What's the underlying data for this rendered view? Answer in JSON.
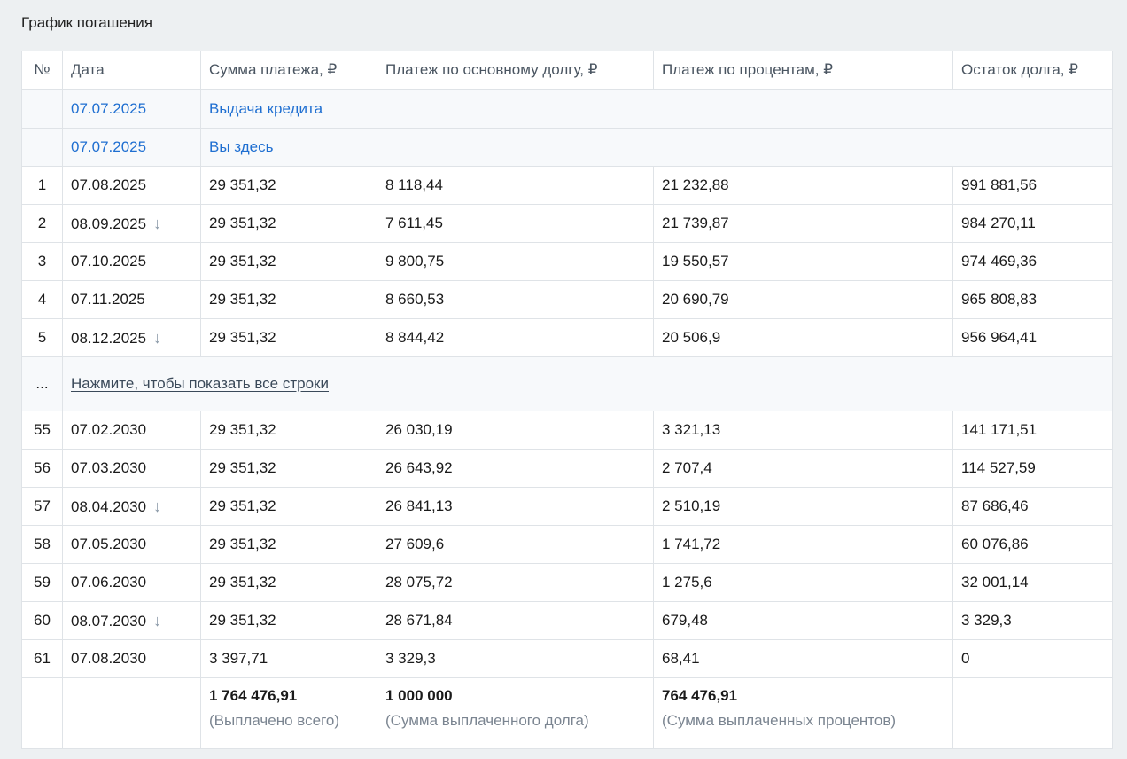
{
  "title": "График погашения",
  "columns": {
    "num": "№",
    "date": "Дата",
    "payment": "Сумма платежа, ₽",
    "principal": "Платеж по основному долгу, ₽",
    "interest": "Платеж по процентам, ₽",
    "balance": "Остаток долга, ₽"
  },
  "events": [
    {
      "date": "07.07.2025",
      "label": "Выдача кредита"
    },
    {
      "date": "07.07.2025",
      "label": "Вы здесь"
    }
  ],
  "rows_top": [
    {
      "num": "1",
      "date": "07.08.2025",
      "shifted": false,
      "payment": "29 351,32",
      "principal": "8 118,44",
      "interest": "21 232,88",
      "balance": "991 881,56"
    },
    {
      "num": "2",
      "date": "08.09.2025",
      "shifted": true,
      "payment": "29 351,32",
      "principal": "7 611,45",
      "interest": "21 739,87",
      "balance": "984 270,11"
    },
    {
      "num": "3",
      "date": "07.10.2025",
      "shifted": false,
      "payment": "29 351,32",
      "principal": "9 800,75",
      "interest": "19 550,57",
      "balance": "974 469,36"
    },
    {
      "num": "4",
      "date": "07.11.2025",
      "shifted": false,
      "payment": "29 351,32",
      "principal": "8 660,53",
      "interest": "20 690,79",
      "balance": "965 808,83"
    },
    {
      "num": "5",
      "date": "08.12.2025",
      "shifted": true,
      "payment": "29 351,32",
      "principal": "8 844,42",
      "interest": "20 506,9",
      "balance": "956 964,41"
    }
  ],
  "expander": {
    "ellipsis": "...",
    "link": "Нажмите, чтобы показать все строки"
  },
  "rows_bottom": [
    {
      "num": "55",
      "date": "07.02.2030",
      "shifted": false,
      "payment": "29 351,32",
      "principal": "26 030,19",
      "interest": "3 321,13",
      "balance": "141 171,51"
    },
    {
      "num": "56",
      "date": "07.03.2030",
      "shifted": false,
      "payment": "29 351,32",
      "principal": "26 643,92",
      "interest": "2 707,4",
      "balance": "114 527,59"
    },
    {
      "num": "57",
      "date": "08.04.2030",
      "shifted": true,
      "payment": "29 351,32",
      "principal": "26 841,13",
      "interest": "2 510,19",
      "balance": "87 686,46"
    },
    {
      "num": "58",
      "date": "07.05.2030",
      "shifted": false,
      "payment": "29 351,32",
      "principal": "27 609,6",
      "interest": "1 741,72",
      "balance": "60 076,86"
    },
    {
      "num": "59",
      "date": "07.06.2030",
      "shifted": false,
      "payment": "29 351,32",
      "principal": "28 075,72",
      "interest": "1 275,6",
      "balance": "32 001,14"
    },
    {
      "num": "60",
      "date": "08.07.2030",
      "shifted": true,
      "payment": "29 351,32",
      "principal": "28 671,84",
      "interest": "679,48",
      "balance": "3 329,3"
    },
    {
      "num": "61",
      "date": "07.08.2030",
      "shifted": false,
      "payment": "3 397,71",
      "principal": "3 329,3",
      "interest": "68,41",
      "balance": "0"
    }
  ],
  "totals": {
    "paid_total": "1 764 476,91",
    "paid_total_caption": "(Выплачено всего)",
    "principal_total": "1 000 000",
    "principal_total_caption": "(Сумма выплаченного долга)",
    "interest_total": "764 476,91",
    "interest_total_caption": "(Сумма выплаченных процентов)"
  },
  "icons": {
    "shifted_date": "arrow-down-icon"
  },
  "colors": {
    "link_blue": "#1f6fd1",
    "background": "#edf0f2",
    "border": "#dfe3e7"
  }
}
